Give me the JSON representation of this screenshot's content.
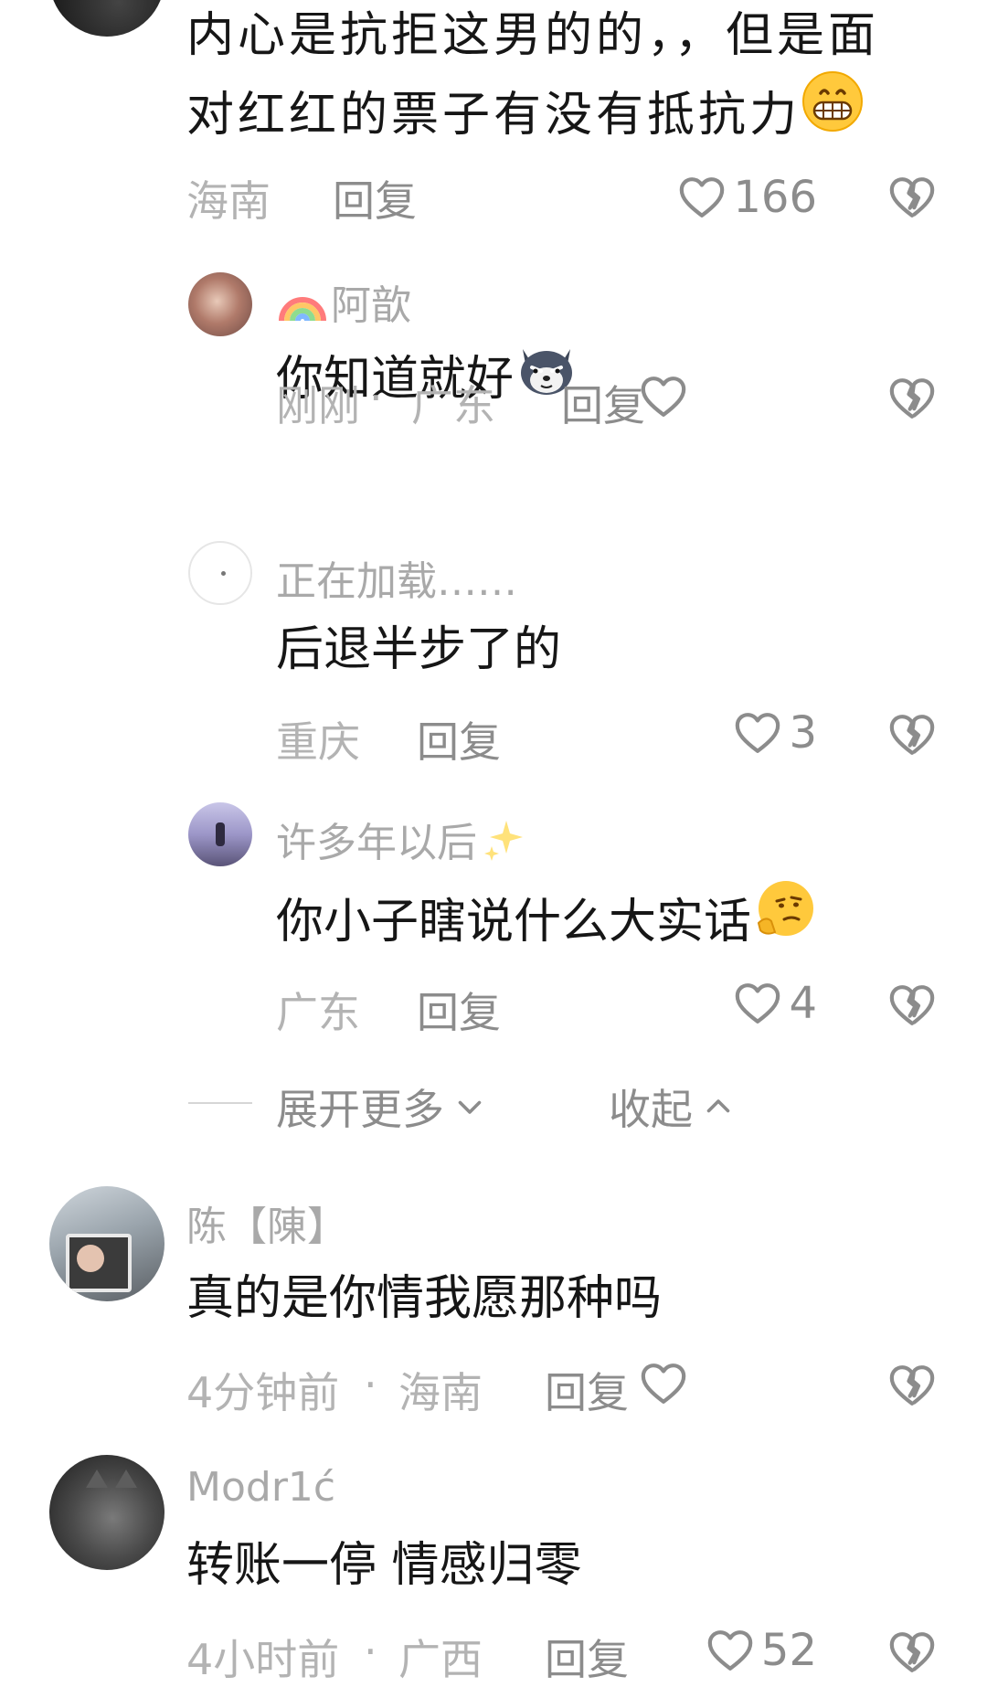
{
  "comments": [
    {
      "content_line1": "内心是抗拒这男的的，，但是面",
      "content_line2": "对红红的票子有没有抵抗力",
      "emoji": "grinning-face-emoji",
      "location": "海南",
      "reply": "回复",
      "likes": "166"
    },
    {
      "username": "阿歆",
      "username_emoji": "rainbow-emoji",
      "content": "你知道就好",
      "emoji": "wolf-sticker-emoji",
      "time": "刚刚",
      "separator": "·",
      "location": "广东",
      "reply": "回复",
      "likes": ""
    },
    {
      "username": "正在加载……",
      "content": "后退半步了的",
      "location": "重庆",
      "reply": "回复",
      "likes": "3"
    },
    {
      "username": "许多年以后",
      "username_emoji": "sparkles-emoji",
      "content": "你小子瞎说什么大实话",
      "emoji": "thinking-face-emoji",
      "location": "广东",
      "reply": "回复",
      "likes": "4"
    },
    {
      "username": "陈【陳】",
      "content": "真的是你情我愿那种吗",
      "time": "4分钟前",
      "separator": "·",
      "location": "海南",
      "reply": "回复",
      "likes": ""
    },
    {
      "username": "Modr1ć",
      "content": "转账一停 情感归零",
      "time": "4小时前",
      "separator": "·",
      "location": "广西",
      "reply": "回复",
      "likes": "52"
    }
  ],
  "thread_controls": {
    "expand_more": "展开更多",
    "collapse": "收起"
  },
  "colors": {
    "text_primary": "#161616",
    "text_secondary": "#a9a9a9",
    "text_meta": "#b3b3b3",
    "icon_gray": "#8c8c8c"
  }
}
